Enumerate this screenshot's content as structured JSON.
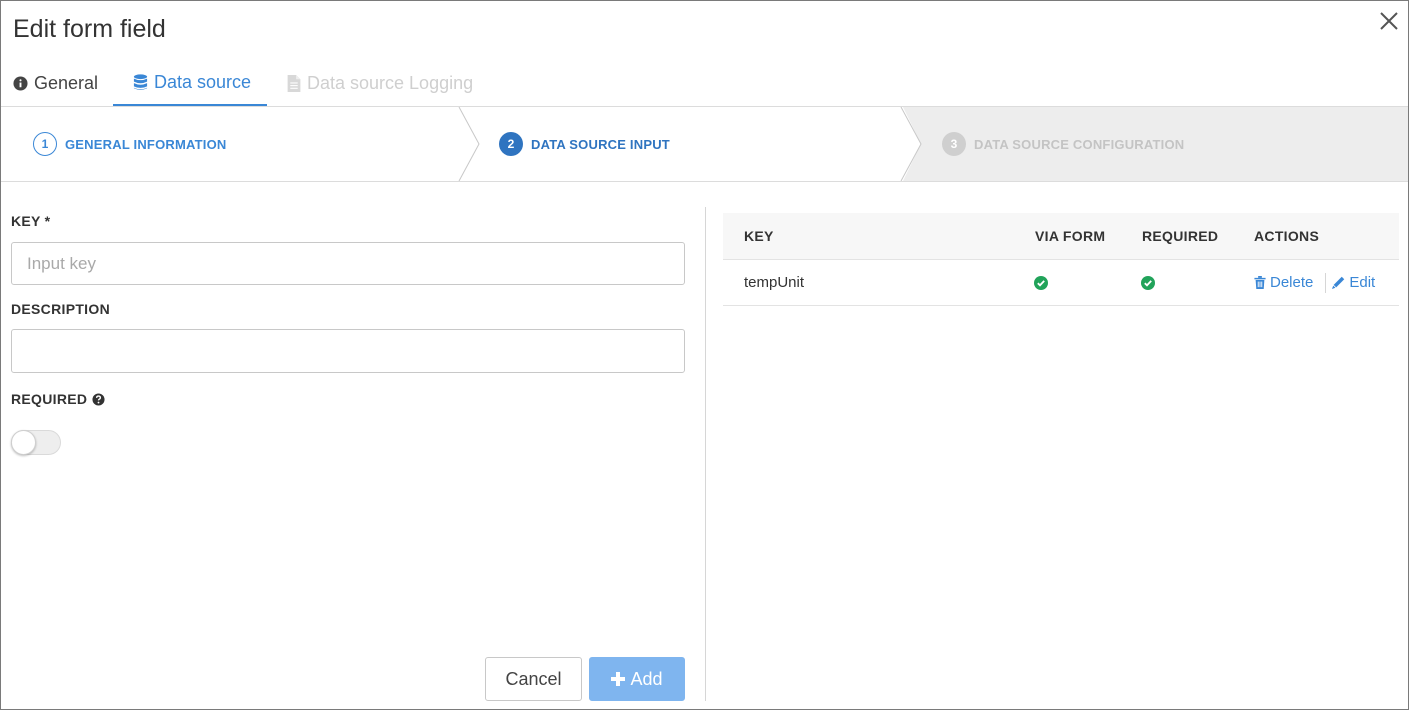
{
  "dialog": {
    "title": "Edit form field"
  },
  "tabs": [
    {
      "label": "General",
      "icon": "info-circle-icon",
      "state": "inactive"
    },
    {
      "label": "Data source",
      "icon": "database-icon",
      "state": "active"
    },
    {
      "label": "Data source Logging",
      "icon": "file-icon",
      "state": "disabled"
    }
  ],
  "steps": [
    {
      "number": "1",
      "label": "GENERAL INFORMATION",
      "state": "completed"
    },
    {
      "number": "2",
      "label": "DATA SOURCE INPUT",
      "state": "active"
    },
    {
      "number": "3",
      "label": "DATA SOURCE CONFIGURATION",
      "state": "upcoming"
    }
  ],
  "form": {
    "key_label": "KEY *",
    "key_placeholder": "Input key",
    "key_value": "",
    "description_label": "DESCRIPTION",
    "description_value": "",
    "required_label": "REQUIRED",
    "required_on": false
  },
  "buttons": {
    "cancel": "Cancel",
    "add": "Add"
  },
  "table": {
    "headers": {
      "key": "KEY",
      "via_form": "VIA FORM",
      "required": "REQUIRED",
      "actions": "ACTIONS"
    },
    "rows": [
      {
        "key": "tempUnit",
        "via_form": true,
        "required": true,
        "delete_label": "Delete",
        "edit_label": "Edit"
      }
    ]
  },
  "colors": {
    "accent": "#3a87d6",
    "success": "#21a35a",
    "disabled": "#cfcfcf",
    "add_button": "#7fb5ef"
  }
}
